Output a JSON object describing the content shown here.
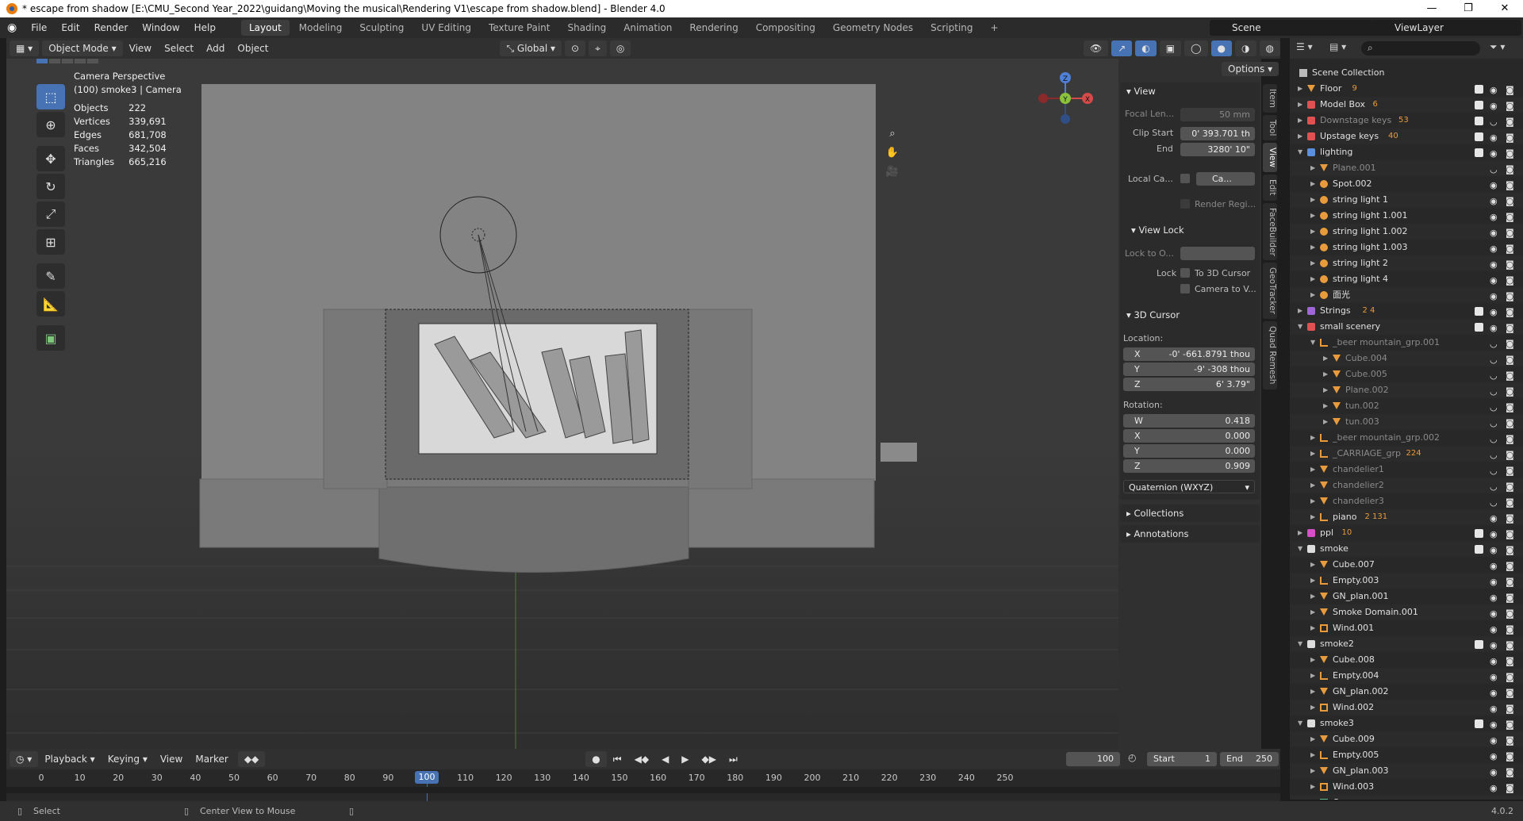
{
  "window": {
    "title": "* escape from shadow [E:\\CMU_Second Year_2022\\guidang\\Moving the musical\\Rendering V1\\escape from shadow.blend] - Blender 4.0",
    "controls": [
      "—",
      "❐",
      "✕"
    ]
  },
  "menu": [
    "File",
    "Edit",
    "Render",
    "Window",
    "Help"
  ],
  "workspaces": [
    "Layout",
    "Modeling",
    "Sculpting",
    "UV Editing",
    "Texture Paint",
    "Shading",
    "Animation",
    "Rendering",
    "Compositing",
    "Geometry Nodes",
    "Scripting"
  ],
  "active_workspace": "Layout",
  "add_workspace": "+",
  "scene": "Scene",
  "view_layer": "ViewLayer",
  "viewport_header": {
    "mode": "Object Mode",
    "menus": [
      "View",
      "Select",
      "Add",
      "Object"
    ],
    "transform_orientation": "Global",
    "options": "Options"
  },
  "overlay_text": {
    "view_name": "Camera Perspective",
    "active": "(100) smoke3 | Camera",
    "stats": [
      {
        "label": "Objects",
        "value": "222"
      },
      {
        "label": "Vertices",
        "value": "339,691"
      },
      {
        "label": "Edges",
        "value": "681,708"
      },
      {
        "label": "Faces",
        "value": "342,504"
      },
      {
        "label": "Triangles",
        "value": "665,216"
      }
    ]
  },
  "gizmo": {
    "z": "Z",
    "y": "Y",
    "x": "X"
  },
  "npanel": {
    "view": {
      "title": "View",
      "focal_label": "Focal Len...",
      "focal_value": "50 mm",
      "clip_start_label": "Clip Start",
      "clip_start_value": "0' 393.701 th",
      "end_label": "End",
      "end_value": "3280' 10\"",
      "local_camera_label": "Local Ca...",
      "local_camera_value": "Ca...",
      "render_region": "Render Regi..."
    },
    "view_lock": {
      "title": "View Lock",
      "lock_to_label": "Lock to O...",
      "lock_label": "Lock",
      "to_3d_cursor": "To 3D Cursor",
      "camera_to_view": "Camera to V..."
    },
    "cursor": {
      "title": "3D Cursor",
      "location_label": "Location:",
      "x_label": "X",
      "x_value": "-0' -661.8791 thou",
      "y_label": "Y",
      "y_value": "-9' -308 thou",
      "z_label": "Z",
      "z_value": "6' 3.79\"",
      "rotation_label": "Rotation:",
      "w_label": "W",
      "w_value": "0.418",
      "rx_label": "X",
      "rx_value": "0.000",
      "ry_label": "Y",
      "ry_value": "0.000",
      "rz_label": "Z",
      "rz_value": "0.909",
      "mode": "Quaternion (WXYZ)"
    },
    "collections": "Collections",
    "annotations": "Annotations",
    "tabs": [
      "Item",
      "Tool",
      "View",
      "Edit",
      "FaceBuilder",
      "GeoTracker",
      "Quad Remesh"
    ]
  },
  "outliner": {
    "root": "Scene Collection",
    "rows": [
      {
        "name": "Floor",
        "depth": 1,
        "type": "obj",
        "color": "#e8c93c",
        "mods": "9",
        "checked": true
      },
      {
        "name": "Model Box",
        "depth": 1,
        "type": "coll",
        "color": "#e05252",
        "mods": "6",
        "checked": true
      },
      {
        "name": "Downstage keys",
        "depth": 1,
        "type": "coll",
        "color": "#e05252",
        "mods": "53",
        "dim": true,
        "checked": true
      },
      {
        "name": "Upstage keys",
        "depth": 1,
        "type": "coll",
        "color": "#e05252",
        "mods": "40",
        "checked": true
      },
      {
        "name": "lighting",
        "depth": 1,
        "type": "coll",
        "color": "#5a8fe0",
        "mods": "",
        "checked": true,
        "open": true
      },
      {
        "name": "Plane.001",
        "depth": 2,
        "type": "mesh",
        "dim": true
      },
      {
        "name": "Spot.002",
        "depth": 2,
        "type": "light"
      },
      {
        "name": "string light 1",
        "depth": 2,
        "type": "light"
      },
      {
        "name": "string light 1.001",
        "depth": 2,
        "type": "light"
      },
      {
        "name": "string light 1.002",
        "depth": 2,
        "type": "light"
      },
      {
        "name": "string light 1.003",
        "depth": 2,
        "type": "light"
      },
      {
        "name": "string light 2",
        "depth": 2,
        "type": "light"
      },
      {
        "name": "string light 4",
        "depth": 2,
        "type": "light"
      },
      {
        "name": "面光",
        "depth": 2,
        "type": "light"
      },
      {
        "name": "Strings",
        "depth": 1,
        "type": "coll",
        "color": "#a066d8",
        "mods": "2 4",
        "checked": true
      },
      {
        "name": "small scenery",
        "depth": 1,
        "type": "coll",
        "color": "#e05252",
        "mods": "",
        "checked": true,
        "open": true
      },
      {
        "name": "_beer mountain_grp.001",
        "depth": 2,
        "type": "empty",
        "dim": true,
        "open": true
      },
      {
        "name": "Cube.004",
        "depth": 3,
        "type": "mesh",
        "dim": true
      },
      {
        "name": "Cube.005",
        "depth": 3,
        "type": "mesh",
        "dim": true
      },
      {
        "name": "Plane.002",
        "depth": 3,
        "type": "mesh",
        "dim": true
      },
      {
        "name": "tun.002",
        "depth": 3,
        "type": "mesh",
        "dim": true
      },
      {
        "name": "tun.003",
        "depth": 3,
        "type": "mesh",
        "dim": true
      },
      {
        "name": "_beer mountain_grp.002",
        "depth": 2,
        "type": "empty",
        "dim": true
      },
      {
        "name": "_CARRIAGE_grp",
        "depth": 2,
        "type": "empty",
        "dim": true,
        "mods": "224"
      },
      {
        "name": "chandelier1",
        "depth": 2,
        "type": "mesh",
        "dim": true
      },
      {
        "name": "chandelier2",
        "depth": 2,
        "type": "mesh",
        "dim": true
      },
      {
        "name": "chandelier3",
        "depth": 2,
        "type": "mesh",
        "dim": true
      },
      {
        "name": "piano",
        "depth": 2,
        "type": "empty",
        "mods": "2 131"
      },
      {
        "name": "ppl",
        "depth": 1,
        "type": "coll",
        "color": "#d84ec8",
        "mods": "10",
        "checked": true
      },
      {
        "name": "smoke",
        "depth": 1,
        "type": "coll",
        "color": "#dddddd",
        "checked": true,
        "open": true
      },
      {
        "name": "Cube.007",
        "depth": 2,
        "type": "mesh"
      },
      {
        "name": "Empty.003",
        "depth": 2,
        "type": "empty"
      },
      {
        "name": "GN_plan.001",
        "depth": 2,
        "type": "mesh"
      },
      {
        "name": "Smoke Domain.001",
        "depth": 2,
        "type": "mesh"
      },
      {
        "name": "Wind.001",
        "depth": 2,
        "type": "force"
      },
      {
        "name": "smoke2",
        "depth": 1,
        "type": "coll",
        "color": "#dddddd",
        "checked": true,
        "open": true
      },
      {
        "name": "Cube.008",
        "depth": 2,
        "type": "mesh"
      },
      {
        "name": "Empty.004",
        "depth": 2,
        "type": "empty"
      },
      {
        "name": "GN_plan.002",
        "depth": 2,
        "type": "mesh"
      },
      {
        "name": "Wind.002",
        "depth": 2,
        "type": "force"
      },
      {
        "name": "smoke3",
        "depth": 1,
        "type": "coll",
        "color": "#dddddd",
        "checked": true,
        "open": true
      },
      {
        "name": "Cube.009",
        "depth": 2,
        "type": "mesh"
      },
      {
        "name": "Empty.005",
        "depth": 2,
        "type": "empty"
      },
      {
        "name": "GN_plan.003",
        "depth": 2,
        "type": "mesh"
      },
      {
        "name": "Wind.003",
        "depth": 2,
        "type": "force"
      },
      {
        "name": "Camera",
        "depth": 2,
        "type": "camera"
      }
    ]
  },
  "timeline": {
    "menus": [
      "Playback",
      "Keying",
      "View",
      "Marker"
    ],
    "current_frame": "100",
    "start_label": "Start",
    "start_value": "1",
    "end_label": "End",
    "end_value": "250",
    "ticks": [
      "0",
      "10",
      "20",
      "30",
      "40",
      "50",
      "60",
      "70",
      "80",
      "90",
      "100",
      "110",
      "120",
      "130",
      "140",
      "150",
      "160",
      "170",
      "180",
      "190",
      "200",
      "210",
      "220",
      "230",
      "240",
      "250"
    ],
    "playhead": "100"
  },
  "statusbar": {
    "select": "Select",
    "center_view": "Center View to Mouse",
    "version": "4.0.2"
  }
}
